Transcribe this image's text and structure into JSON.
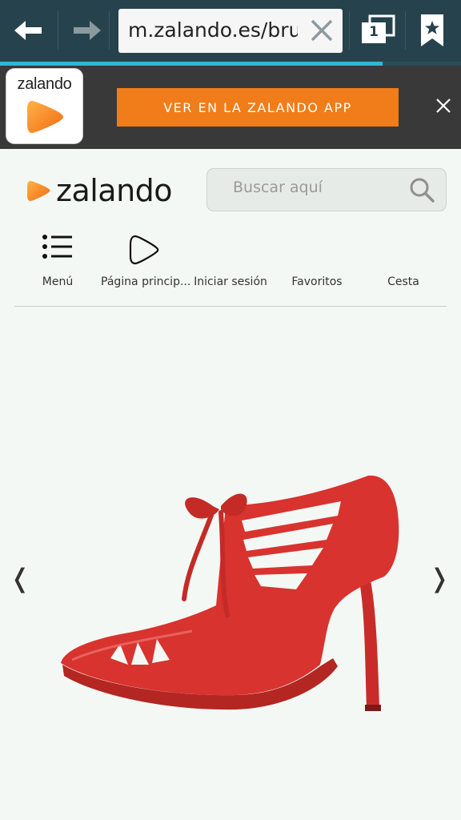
{
  "browser": {
    "url": "m.zalando.es/bruno",
    "tab_count": "1",
    "progress_fraction": 0.83,
    "colors": {
      "toolbar": "#26434d",
      "progress": "#32b5d6"
    }
  },
  "app_banner": {
    "icon_label": "zalando",
    "button_label": "VER EN LA ZALANDO APP",
    "colors": {
      "button": "#f07d1a",
      "background": "#393939"
    }
  },
  "header": {
    "logo_text": "zalando",
    "search_placeholder": "Buscar aquí"
  },
  "nav": {
    "items": [
      {
        "label": "Menú",
        "icon": "menu-list-icon"
      },
      {
        "label": "Página princip...",
        "icon": "zalando-play-icon"
      },
      {
        "label": "Iniciar sesión",
        "icon": ""
      },
      {
        "label": "Favoritos",
        "icon": ""
      },
      {
        "label": "Cesta",
        "icon": ""
      }
    ]
  },
  "gallery": {
    "prev_label": "❬",
    "next_label": "❭",
    "product_color": "#d8332f"
  }
}
